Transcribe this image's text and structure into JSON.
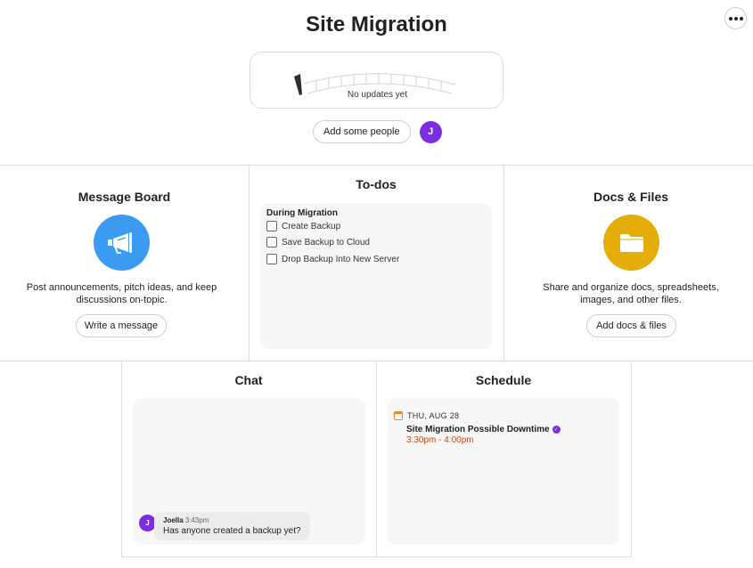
{
  "header": {
    "title": "Site Migration",
    "more_icon": "ellipsis-icon"
  },
  "activity": {
    "status_text": "No updates yet"
  },
  "people": {
    "add_label": "Add some people",
    "avatar_initial": "J"
  },
  "message_board": {
    "title": "Message Board",
    "icon": "megaphone-icon",
    "icon_color": "#3b9af2",
    "description_line1": "Post announcements, pitch ideas, and keep",
    "description_line2": "discussions on-topic.",
    "button_label": "Write a message"
  },
  "todos": {
    "title": "To-dos",
    "group_name": "During Migration",
    "items": [
      {
        "label": "Create Backup",
        "checked": false
      },
      {
        "label": "Save Backup to Cloud",
        "checked": false
      },
      {
        "label": "Drop Backup Into New Server",
        "checked": false
      }
    ]
  },
  "docs": {
    "title": "Docs & Files",
    "icon": "folder-icon",
    "icon_color": "#e4ad07",
    "description_line1": "Share and organize docs, spreadsheets,",
    "description_line2": "images, and other files.",
    "button_label": "Add docs & files"
  },
  "chat": {
    "title": "Chat",
    "messages": [
      {
        "author": "Joella",
        "initial": "J",
        "time": "3:43pm",
        "text": "Has anyone created a backup yet?"
      }
    ]
  },
  "schedule": {
    "title": "Schedule",
    "date": "THU, AUG 28",
    "event_title": "Site Migration Possible Downtime",
    "event_time": "3:30pm - 4:00pm",
    "accent_color": "#e8862a"
  }
}
